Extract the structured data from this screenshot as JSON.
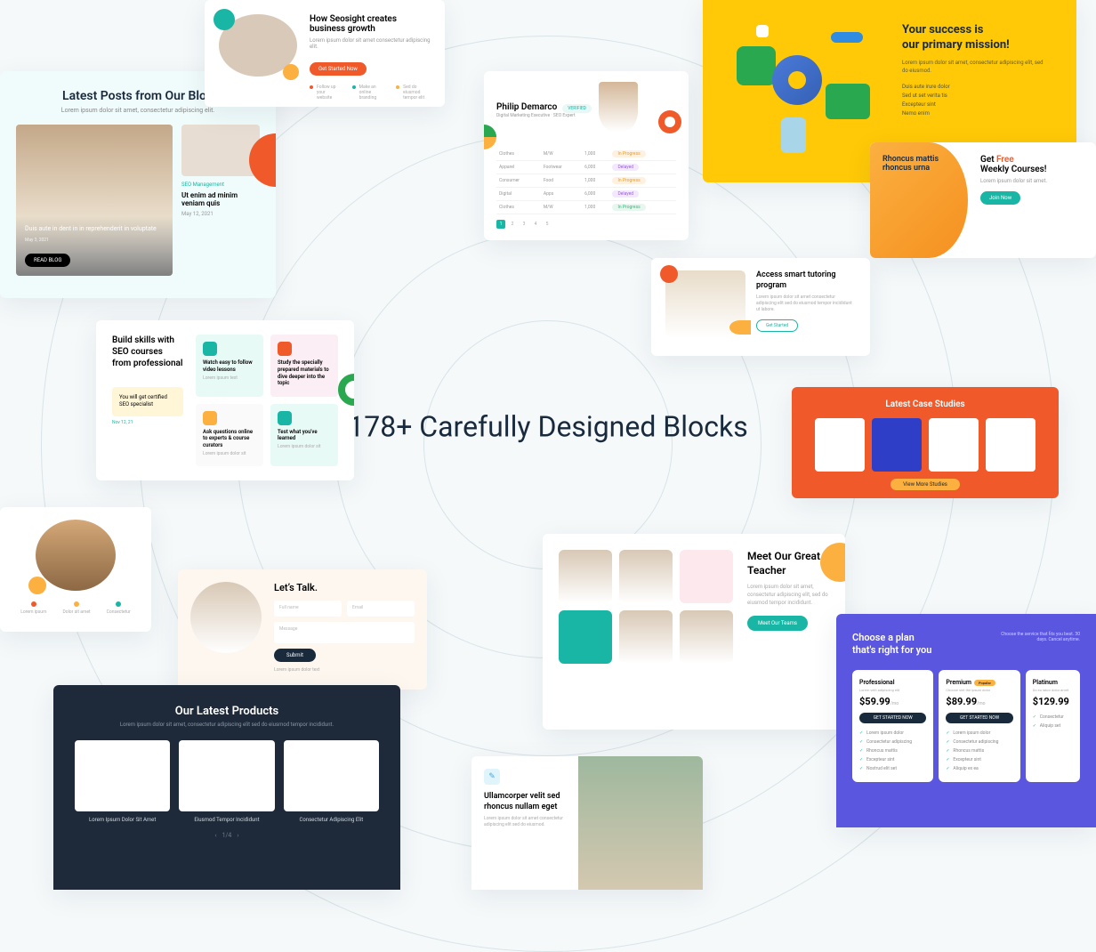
{
  "headline": "178+ Carefully Designed Blocks",
  "blog": {
    "title": "Latest Posts from Our Blog",
    "subtitle": "Lorem ipsum dolor sit amet, consectetur adipiscing elit.",
    "main_excerpt": "Duis aute in dent in in reprehenderit in voluptate",
    "main_date": "May 3, 2021",
    "read_btn": "READ BLOG",
    "side_category": "SEO Management",
    "side_title": "Ut enim ad minim veniam quis",
    "side_date": "May 12, 2021"
  },
  "growth": {
    "title": "How Seosight creates business growth",
    "desc": "Lorem ipsum dolor sit amet consectetur adipiscing elit.",
    "btn": "Get Started Now",
    "feat1": "Follow up your website",
    "feat2": "Make an online branding",
    "feat3": "Sed do eiusmod tempor elit"
  },
  "dash": {
    "name": "Philip Demarco",
    "badge": "VERIFIED",
    "role": "Digital Marketing Executive · SEO Expert",
    "pager": [
      "1",
      "2",
      "3",
      "4",
      "5"
    ],
    "rows": [
      {
        "a": "Clothes",
        "b": "M/W",
        "c": "1,000",
        "d": "In Progress"
      },
      {
        "a": "Apparel",
        "b": "Footwear",
        "c": "6,000",
        "d": "Delayed"
      },
      {
        "a": "Consumer",
        "b": "Food",
        "c": "1,000",
        "d": "In Progress"
      },
      {
        "a": "Digital",
        "b": "Apps",
        "c": "6,000",
        "d": "Delayed"
      },
      {
        "a": "Clothes",
        "b": "M/W",
        "c": "1,000",
        "d": "In Progress"
      }
    ]
  },
  "yellow": {
    "title1": "Your success is",
    "title2": "our primary mission!",
    "desc": "Lorem ipsum dolor sit amet, consectetur adipiscing elit, sed do eiusmod.",
    "b1": "Duis aute irure dolor",
    "b2": "Sed ut set verita tis",
    "b3": "Excepteur sint",
    "b4": "Nemo enim"
  },
  "courses": {
    "left_title": "Rhoncus mattis rhoncus urna",
    "right_title1": "Get ",
    "right_free": "Free",
    "right_title2": "Weekly Courses!",
    "desc": "Lorem ipsum dolor sit amet.",
    "btn": "Join Now"
  },
  "tutor": {
    "title": "Access smart tutoring program",
    "desc": "Lorem ipsum dolor sit amet consectetur adipiscing elit sed do eiusmod tempor incididunt ut labore.",
    "btn": "Get Started"
  },
  "skills": {
    "title": "Build skills with SEO courses from professional",
    "note": "You will get certified SEO specialist",
    "date": "Nov 12, 21",
    "cells": [
      {
        "t": "Watch easy to follow video lessons",
        "d": "Lorem ipsum text"
      },
      {
        "t": "Study the specially prepared materials to dive deeper into the topic",
        "d": ""
      },
      {
        "t": "Ask questions online to experts & course curators",
        "d": "Lorem ipsum dolor sit"
      },
      {
        "t": "Test what you've learned",
        "d": "Lorem ipsum dolor sit"
      }
    ]
  },
  "cases": {
    "title": "Latest Case Studies",
    "btn": "View More Studies"
  },
  "man": {
    "f1": "Lorem ipsum",
    "f2": "Dolor sit amet",
    "f3": "Consectetur"
  },
  "talk": {
    "title": "Let’s Talk.",
    "p1": "Full name",
    "p2": "Email",
    "p3": "Message",
    "btn": "Submit",
    "line": "Lorem ipsum dolor text"
  },
  "teachers": {
    "title": "Meet Our Great Teacher",
    "desc": "Lorem ipsum dolor sit amet, consectetur adipiscing elit, sed do eiusmod tempor incididunt.",
    "btn": "Meet Our Teams"
  },
  "pricing": {
    "title1": "Choose a plan",
    "title2": "that's right for you",
    "sub": "Choose the service that fits you best. 30 days. Cancel anytime.",
    "plans": [
      {
        "name": "Professional",
        "desc": "Lorem velit adipiscing elit",
        "price": "$59.99",
        "per": "/mo",
        "btn": "GET STARTED NOW",
        "feats": [
          "Lorem ipsum dolor",
          "Consectetur adipiscing",
          "Rhoncus mattis",
          "Excepteur sint",
          "Nostrud elit set"
        ]
      },
      {
        "name": "Premium",
        "badge": "Popular",
        "desc": "Choose sint the ipsum dolor",
        "price": "$89.99",
        "per": "/mo",
        "btn": "GET STARTED NOW",
        "feats": [
          "Lorem ipsum dolor",
          "Consectetur adipiscing",
          "Rhoncus mattis",
          "Excepteur sint",
          "Aliquip ex ea"
        ]
      },
      {
        "name": "Platinum",
        "desc": "Do eu labor dolor amet",
        "price": "$129.99",
        "per": "/mo",
        "btn": "",
        "feats": [
          "Consectetur",
          "Aliquip set"
        ]
      }
    ]
  },
  "products": {
    "title": "Our Latest Products",
    "desc": "Lorem ipsum dolor sit amet, consectetur adipiscing elit sed do eiusmod tempor incididunt.",
    "caps": [
      "Lorem Ipsum Dolor Sit Amet",
      "Eiusmod Tempor Incididunt",
      "Consectetur Adipiscing Elit"
    ],
    "prev": "‹",
    "page": "1/4",
    "next": "›"
  },
  "ulla": {
    "title": "Ullamcorper velit sed rhoncus nullam eget",
    "desc": "Lorem ipsum dolor sit amet consectetur adipiscing elit sed do eiusmod."
  }
}
